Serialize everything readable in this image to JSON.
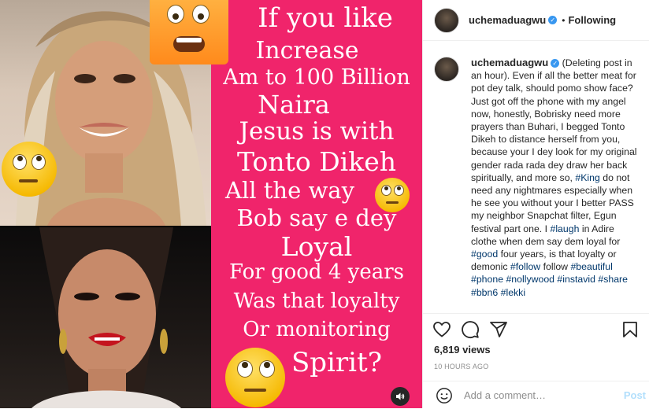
{
  "header": {
    "username": "uchemaduagwu",
    "separator": "•",
    "follow_label": "Following"
  },
  "media": {
    "overlay_lines": [
      "If you like",
      "Increase",
      "Am to 100 Billion",
      "Naira",
      "Jesus is with",
      "Tonto Dikeh",
      "All the way",
      "Bob say e dey",
      "Loyal",
      "For good 4 years",
      "Was that loyalty",
      "Or monitoring",
      "Spirit?"
    ],
    "sound_icon": "speaker-icon",
    "colors": {
      "panel": "#f0246b",
      "emoji": "#f5b800"
    }
  },
  "caption": {
    "username": "uchemaduagwu",
    "segments": [
      {
        "t": "(Deleting post in an hour). Even if all the better meat for pot dey talk, should pomo show face? Just got off the phone with my angel now, honestly, Bobrisky need more prayers than Buhari, I begged Tonto Dikeh to distance herself from you, because your I dey look for my original gender rada rada dey draw her back spiritually, and more so, "
      },
      {
        "t": "#King",
        "tag": true
      },
      {
        "t": " do not need any nightmares especially when he see you without your I better PASS my neighbor Snapchat filter, Egun festival part one. I "
      },
      {
        "t": "#laugh",
        "tag": true
      },
      {
        "t": " in Adire clothe when dem say dem loyal for "
      },
      {
        "t": "#good",
        "tag": true
      },
      {
        "t": " four years, is that loyalty or demonic "
      },
      {
        "t": "#follow",
        "tag": true
      },
      {
        "t": " follow "
      },
      {
        "t": "#beautiful",
        "tag": true
      },
      {
        "t": " "
      },
      {
        "t": "#phone",
        "tag": true
      },
      {
        "t": " "
      },
      {
        "t": "#nollywood",
        "tag": true
      },
      {
        "t": " "
      },
      {
        "t": "#instavid",
        "tag": true
      },
      {
        "t": " "
      },
      {
        "t": "#share",
        "tag": true
      },
      {
        "t": " "
      },
      {
        "t": "#bbn6",
        "tag": true
      },
      {
        "t": " "
      },
      {
        "t": "#lekki",
        "tag": true
      }
    ]
  },
  "stats": {
    "views": "6,819 views",
    "time_ago": "10 HOURS AGO"
  },
  "actions": {
    "like_icon": "heart-icon",
    "comment_icon": "comment-icon",
    "share_icon": "share-icon",
    "save_icon": "bookmark-icon"
  },
  "comment": {
    "placeholder": "Add a comment…",
    "post_label": "Post",
    "emoji_icon": "smiley-icon"
  }
}
